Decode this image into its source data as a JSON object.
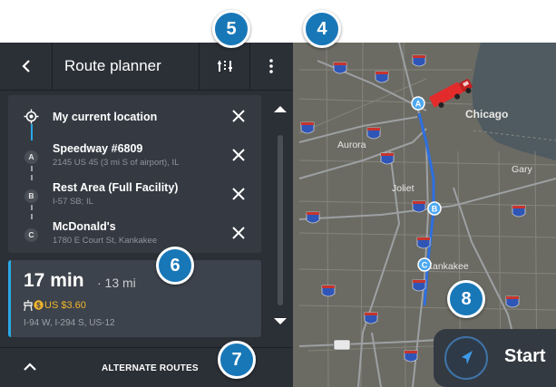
{
  "header": {
    "title": "Route planner",
    "back_icon": "chevron-left-icon",
    "options_icon": "route-options-icon",
    "more_icon": "more-vertical-icon"
  },
  "stops": [
    {
      "marker": "",
      "name": "My current location",
      "address": "",
      "icon": "current-location-icon"
    },
    {
      "marker": "A",
      "name": "Speedway #6809",
      "address": "2145 US 45 (3 mi S of airport), IL"
    },
    {
      "marker": "B",
      "name": "Rest Area (Full Facility)",
      "address": "I-57 SB; IL"
    },
    {
      "marker": "C",
      "name": "McDonald's",
      "address": "1780 E Court St, Kankakee"
    }
  ],
  "route": {
    "time": "17 min",
    "distance": "· 13 mi",
    "toll_currency": "US",
    "toll_amount": "US $3.60",
    "roads": "I-94 W, I-294 S, US-12"
  },
  "footer": {
    "alternate_routes": "ALTERNATE ROUTES"
  },
  "start": {
    "label": "Start"
  },
  "map": {
    "cities": [
      "Chicago",
      "Aurora",
      "Joliet",
      "Gary",
      "Kankakee"
    ],
    "shields": [
      "90",
      "94",
      "290",
      "88",
      "55",
      "80",
      "57",
      "65",
      "24"
    ]
  },
  "badges": [
    "5",
    "4",
    "6",
    "7",
    "8"
  ],
  "colors": {
    "panel": "#2b2f36",
    "accent": "#29a8e6",
    "badge": "#1877b7",
    "map": "#6b6b63",
    "water": "#4f5a61",
    "truck": "#e32b2b"
  }
}
